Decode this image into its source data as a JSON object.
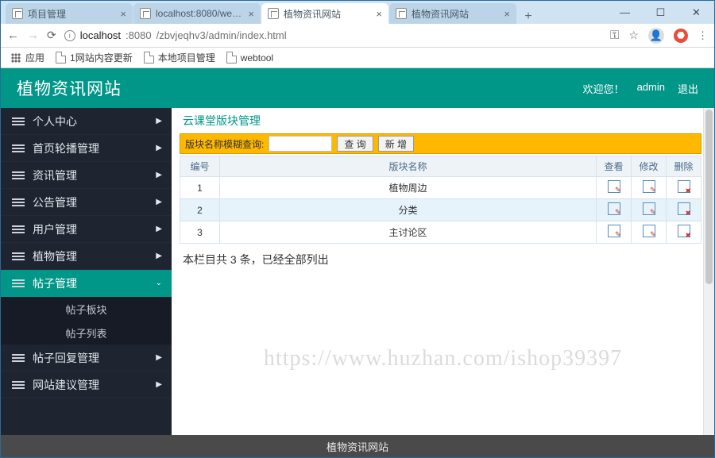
{
  "browser": {
    "tabs": [
      {
        "label": "项目管理",
        "active": false,
        "icon": "doc"
      },
      {
        "label": "localhost:8080/webtool/all/in",
        "active": false,
        "icon": "doc"
      },
      {
        "label": "植物资讯网站",
        "active": true,
        "icon": "doc"
      },
      {
        "label": "植物资讯网站",
        "active": false,
        "icon": "doc"
      }
    ],
    "address": {
      "host": "localhost",
      "port": ":8080",
      "path": "/zbvjeqhv3/admin/index.html"
    },
    "bookmarks": {
      "apps": "应用",
      "items": [
        "1网站内容更新",
        "本地项目管理",
        "webtool"
      ]
    }
  },
  "header": {
    "brand": "植物资讯网站",
    "welcome": "欢迎您！",
    "user": "admin",
    "logout": "退出"
  },
  "sidebar": {
    "items": [
      {
        "label": "个人中心",
        "caret": "▶"
      },
      {
        "label": "首页轮播管理",
        "caret": "▶"
      },
      {
        "label": "资讯管理",
        "caret": "▶"
      },
      {
        "label": "公告管理",
        "caret": "▶"
      },
      {
        "label": "用户管理",
        "caret": "▶"
      },
      {
        "label": "植物管理",
        "caret": "▶"
      },
      {
        "label": "帖子管理",
        "caret": "⌄",
        "active": true,
        "subs": [
          "帖子板块",
          "帖子列表"
        ]
      },
      {
        "label": "帖子回复管理",
        "caret": "▶"
      },
      {
        "label": "网站建议管理",
        "caret": "▶"
      }
    ]
  },
  "panel": {
    "title": "云课堂版块管理",
    "search_label": "版块名称模糊查询:",
    "search_value": "",
    "btn_search": "查 询",
    "btn_new": "新 增",
    "columns": {
      "idx": "编号",
      "name": "版块名称",
      "view": "查看",
      "edit": "修改",
      "del": "删除"
    },
    "rows": [
      {
        "idx": "1",
        "name": "植物周边"
      },
      {
        "idx": "2",
        "name": "分类"
      },
      {
        "idx": "3",
        "name": "主讨论区"
      }
    ],
    "info": "本栏目共 3 条，已经全部列出"
  },
  "watermark": "https://www.huzhan.com/ishop39397",
  "footer": "植物资讯网站"
}
